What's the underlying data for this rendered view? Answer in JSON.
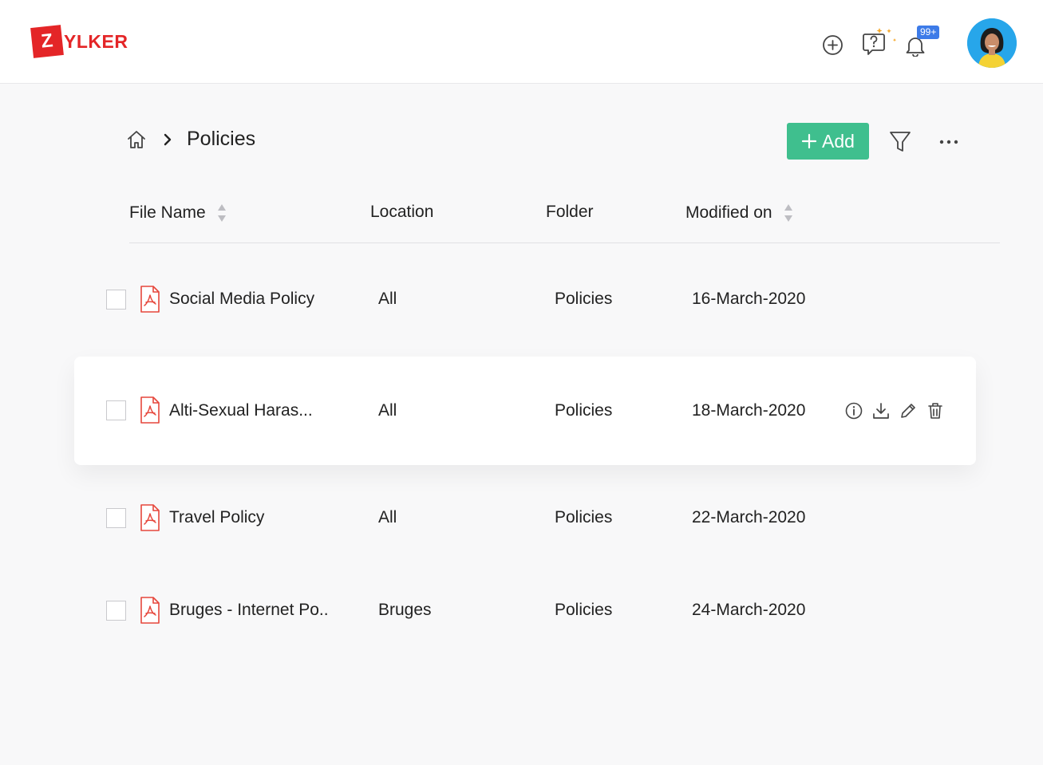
{
  "brand": {
    "logo_letter": "Z",
    "logo_rest": "YLKER",
    "color": "#e42527"
  },
  "header": {
    "icons": [
      "add-circle-icon",
      "help-chat-icon",
      "bell-icon"
    ],
    "notification_badge": "99+",
    "avatar": "user-avatar"
  },
  "breadcrumb": {
    "home_icon": "home-icon",
    "separator_icon": "chevron-right-icon",
    "title": "Policies"
  },
  "toolbar": {
    "add_label": "Add",
    "add_color": "#3fbf8e",
    "filter_icon": "filter-icon",
    "more_icon": "more-horizontal-icon"
  },
  "table": {
    "columns": {
      "file_name": "File Name",
      "location": "Location",
      "folder": "Folder",
      "modified_on": "Modified on"
    },
    "rows": [
      {
        "name": "Social Media Policy",
        "location": "All",
        "folder": "Policies",
        "modified": "16-March-2020"
      },
      {
        "name": "Alti-Sexual Haras...",
        "location": "All",
        "folder": "Policies",
        "modified": "18-March-2020",
        "hovered": true
      },
      {
        "name": "Travel Policy",
        "location": "All",
        "folder": "Policies",
        "modified": "22-March-2020"
      },
      {
        "name": "Bruges - Internet Po..",
        "location": "Bruges",
        "folder": "Policies",
        "modified": "24-March-2020"
      }
    ],
    "row_actions": [
      "info-icon",
      "download-icon",
      "edit-icon",
      "delete-icon"
    ]
  }
}
